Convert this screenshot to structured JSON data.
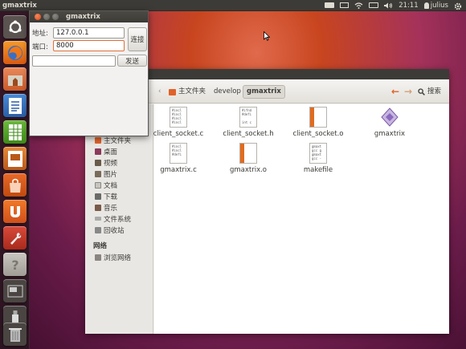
{
  "top_panel": {
    "app_name": "gmaxtrix",
    "time": "21:11",
    "user": "julius",
    "indicators": [
      "keyboard-icon",
      "mail-icon",
      "network-icon",
      "battery-icon",
      "volume-icon",
      "user-icon",
      "gear-icon"
    ]
  },
  "launcher": {
    "items": [
      "dash-home",
      "firefox",
      "files",
      "libreoffice-writer",
      "libreoffice-calc",
      "libreoffice-impress",
      "software-center",
      "ubuntu-one",
      "system-settings",
      "unknown-app",
      "workspace-switcher",
      "usb-drive",
      "trash"
    ]
  },
  "dialog": {
    "title": "gmaxtrix",
    "address_label": "地址:",
    "address_value": "127.0.0.1",
    "port_label": "端口:",
    "port_value": "8000",
    "connect_label": "连接",
    "message_value": "",
    "send_label": "发送"
  },
  "file_manager": {
    "breadcrumbs": [
      "主文件夹",
      "develop",
      "gmaxtrix"
    ],
    "search_label": "搜索",
    "sidebar": {
      "items": [
        "主文件夹",
        "桌面",
        "视频",
        "图片",
        "文档",
        "下载",
        "音乐",
        "文件系统",
        "回收站"
      ],
      "network_heading": "网络",
      "network_items": [
        "浏览网络"
      ]
    },
    "files": [
      {
        "name": "client_socket.c",
        "type": "c-source",
        "preview": "#incl\n#incl\n#incl\n#incl"
      },
      {
        "name": "client_socket.h",
        "type": "c-header",
        "preview": "#ifnd\n#defi\n\nint c"
      },
      {
        "name": "client_socket.o",
        "type": "object",
        "preview": ""
      },
      {
        "name": "gmaxtrix",
        "type": "executable",
        "preview": ""
      },
      {
        "name": "gmaxtrix.c",
        "type": "c-source",
        "preview": "#incl\n#incl\n#defi"
      },
      {
        "name": "gmaxtrix.o",
        "type": "object",
        "preview": ""
      },
      {
        "name": "makefile",
        "type": "text",
        "preview": "gmaxt\ngcc g\ngmaxt\ngcc -"
      }
    ]
  },
  "colors": {
    "panel": "#3c3b37",
    "accent": "#dd4814",
    "close_button": "#e5541d"
  }
}
